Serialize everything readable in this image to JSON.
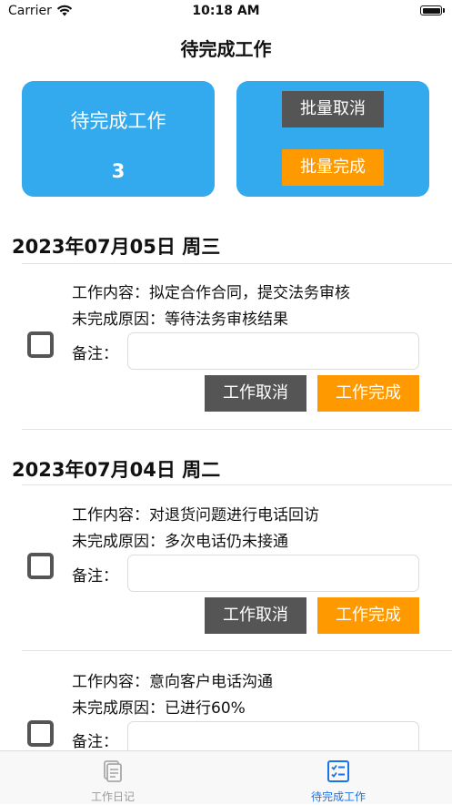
{
  "status_bar": {
    "carrier": "Carrier",
    "time": "10:18 AM"
  },
  "nav": {
    "title": "待完成工作"
  },
  "summary": {
    "label": "待完成工作",
    "count": "3"
  },
  "batch": {
    "cancel_label": "批量取消",
    "complete_label": "批量完成"
  },
  "groups": [
    {
      "date": "2023年07月05日 周三"
    },
    {
      "date": "2023年07月04日 周二"
    }
  ],
  "tasks": [
    {
      "content": "工作内容：拟定合作合同，提交法务审核",
      "reason": "未完成原因：等待法务审核结果",
      "note_label": "备注：",
      "note_value": "",
      "cancel_label": "工作取消",
      "complete_label": "工作完成"
    },
    {
      "content": "工作内容：对退货问题进行电话回访",
      "reason": "未完成原因：多次电话仍未接通",
      "note_label": "备注：",
      "note_value": "",
      "cancel_label": "工作取消",
      "complete_label": "工作完成"
    },
    {
      "content": "工作内容：意向客户电话沟通",
      "reason": "未完成原因：已进行60%",
      "note_label": "备注：",
      "note_value": ""
    }
  ],
  "tab_bar": {
    "items": [
      {
        "label": "工作日记",
        "icon": "document-icon",
        "active": false
      },
      {
        "label": "待完成工作",
        "icon": "checklist-icon",
        "active": true
      }
    ]
  },
  "colors": {
    "accent": "#33aaee",
    "orange": "#ff9900",
    "dark_button": "#555555",
    "tab_active": "#1a73e8"
  }
}
